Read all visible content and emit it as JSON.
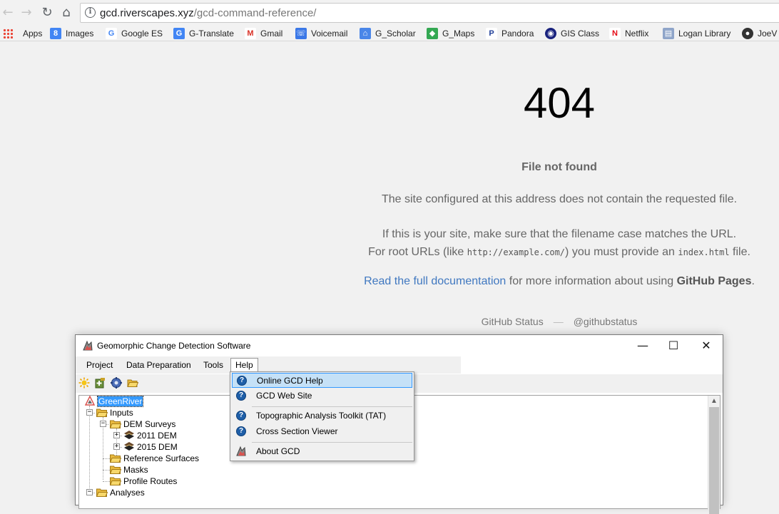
{
  "browser": {
    "url_host": "gcd.riverscapes.xyz",
    "url_path": "/gcd-command-reference/",
    "bookmarks": [
      "Apps",
      "Images",
      "Google ES",
      "G-Translate",
      "Gmail",
      "Voicemail",
      "G_Scholar",
      "G_Maps",
      "Pandora",
      "GIS Class",
      "Netflix",
      "Logan Library",
      "JoeV"
    ]
  },
  "page404": {
    "code": "404",
    "heading": "File not found",
    "line1": "The site configured at this address does not contain the requested file.",
    "line2": "If this is your site, make sure that the filename case matches the URL.",
    "line3_pre": "For root URLs (like ",
    "line3_code1": "http://example.com/",
    "line3_mid": ") you must provide an ",
    "line3_code2": "index.html",
    "line3_post": " file.",
    "doc_link": "Read the full documentation",
    "doc_mid": " for more information about using ",
    "doc_bold": "GitHub Pages",
    "doc_end": ".",
    "footer_status": "GitHub Status",
    "footer_sep": "—",
    "footer_handle": "@githubstatus"
  },
  "gcd": {
    "title": "Geomorphic Change Detection Software",
    "window_controls": [
      "—",
      "☐",
      "✕"
    ],
    "menu": [
      "Project",
      "Data Preparation",
      "Tools",
      "Help"
    ],
    "tree": {
      "root": "GreenRiver",
      "inputs": "Inputs",
      "dem_surveys": "DEM Surveys",
      "dem1": "2011 DEM",
      "dem2": "2015 DEM",
      "reference_surfaces": "Reference Surfaces",
      "masks": "Masks",
      "profile_routes": "Profile Routes",
      "analyses": "Analyses"
    },
    "help_menu": [
      "Online GCD Help",
      "GCD Web Site",
      "Topographic Analysis Toolkit (TAT)",
      "Cross Section Viewer",
      "About GCD"
    ]
  }
}
